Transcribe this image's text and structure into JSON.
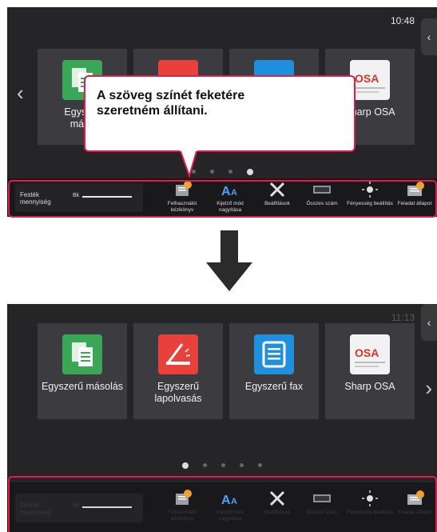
{
  "callout": {
    "line1": "A szöveg színét feketére",
    "line2": "szeretném állítani."
  },
  "before": {
    "clock": "10:48",
    "apps": [
      {
        "label": "Egyszerű másolás",
        "visible_text": "Egyszer\nmáso"
      },
      {
        "label": "Sharp OSA",
        "visible_text": "Sharp OSA"
      }
    ],
    "dots": 4,
    "active_dot_index": 3
  },
  "after": {
    "clock": "11:13",
    "apps": [
      {
        "label": "Egyszerű másolás",
        "icon": "copy-icon",
        "color": "#3aa757"
      },
      {
        "label": "Egyszerű lapolvasás",
        "icon": "scan-icon",
        "color": "#e8413b"
      },
      {
        "label": "Egyszerű fax",
        "icon": "fax-icon",
        "color": "#1f8fe0"
      },
      {
        "label": "Sharp OSA",
        "icon": "osa-icon",
        "color": "#f2f2f2"
      }
    ],
    "dots": 5,
    "active_dot_index": 0
  },
  "bottom_bar": {
    "toner_label": "Festék mennyiség",
    "toner_color_code": "Bk",
    "tools": [
      {
        "label": "Felhasználói kézikönyv",
        "icon": "manual-icon"
      },
      {
        "label": "Kijelző mód nagyítása",
        "icon": "zoom-text-icon"
      },
      {
        "label": "Beállítások",
        "icon": "settings-tools-icon"
      },
      {
        "label": "Összes szám",
        "icon": "counter-icon"
      },
      {
        "label": "Fényesség beállítás",
        "icon": "brightness-icon"
      },
      {
        "label": "Feladat állapot",
        "icon": "job-status-icon"
      }
    ]
  },
  "colors": {
    "highlight": "#e6194b",
    "screen_bg": "#252527",
    "tile_bg": "#3c3c40",
    "arrow": "#2b2b2b"
  }
}
